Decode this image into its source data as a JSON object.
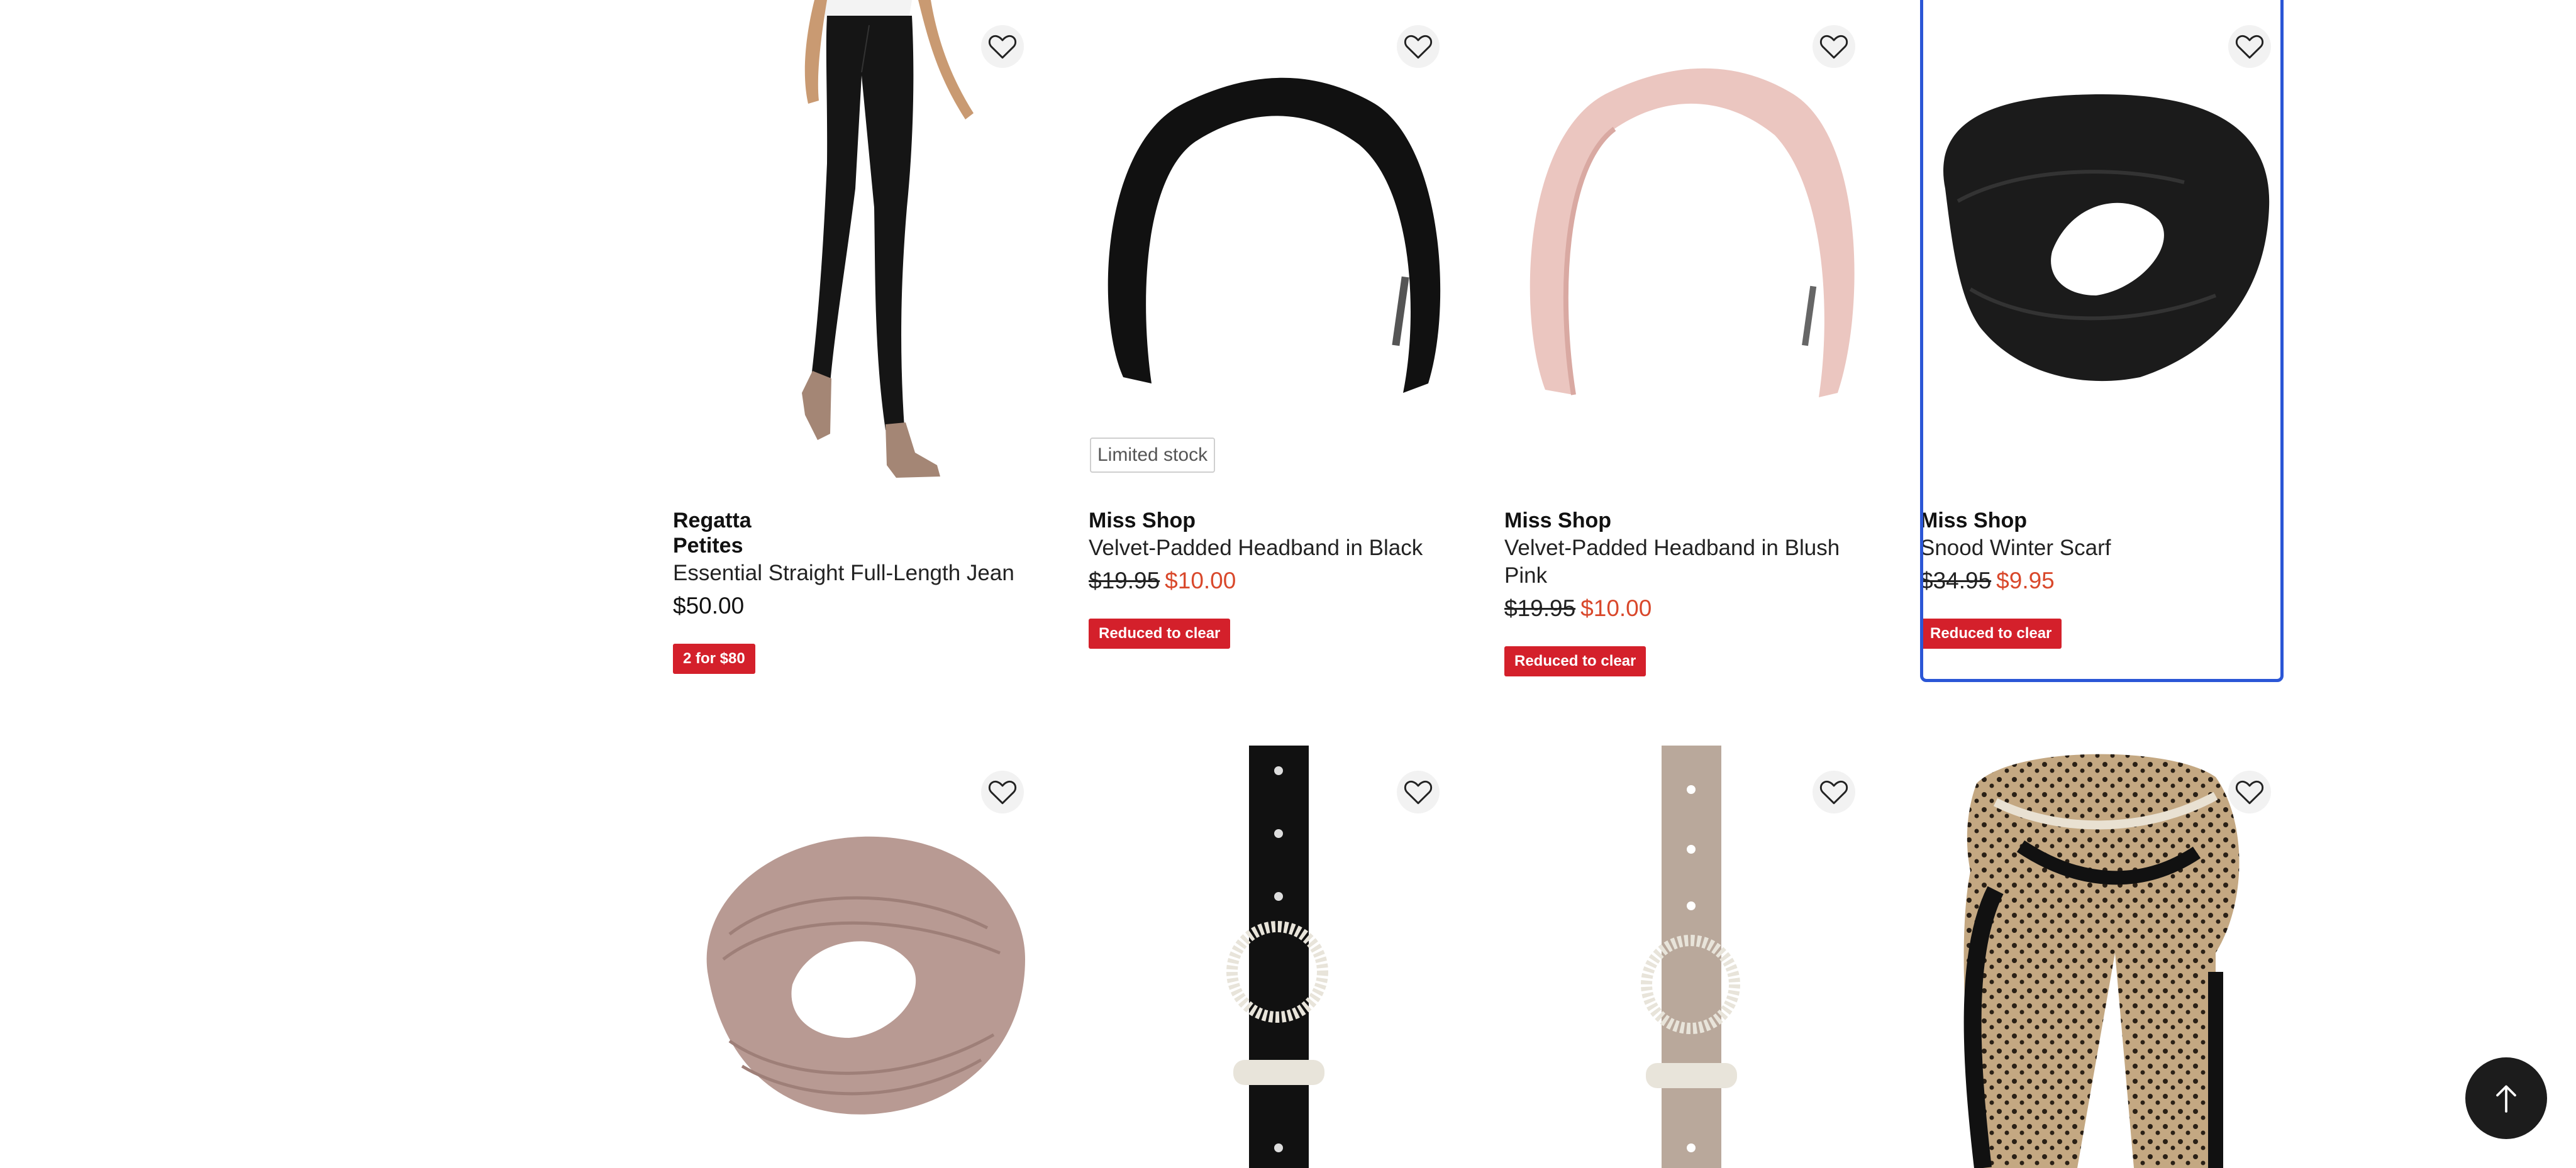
{
  "products": [
    {
      "brand": "Regatta\nPetites",
      "name": "Essential Straight Full-Length Jean",
      "price": "$50.00",
      "promo": "2 for $80"
    },
    {
      "stock_tag": "Limited stock",
      "brand": "Miss Shop",
      "name": "Velvet-Padded Headband in Black",
      "was_price": "$19.95",
      "now_price": "$10.00",
      "promo": "Reduced to clear"
    },
    {
      "brand": "Miss Shop",
      "name": "Velvet-Padded Headband in Blush Pink",
      "was_price": "$19.95",
      "now_price": "$10.00",
      "promo": "Reduced to clear"
    },
    {
      "brand": "Miss Shop",
      "name": "Snood Winter Scarf",
      "was_price": "$34.95",
      "now_price": "$9.95",
      "promo": "Reduced to clear"
    }
  ],
  "icons": {
    "wishlist": "heart-outline-icon",
    "back_to_top": "arrow-up-icon"
  },
  "colors": {
    "sale_price": "#d9482b",
    "promo_badge": "#d4202b",
    "selected_outline": "#2b56d6"
  }
}
